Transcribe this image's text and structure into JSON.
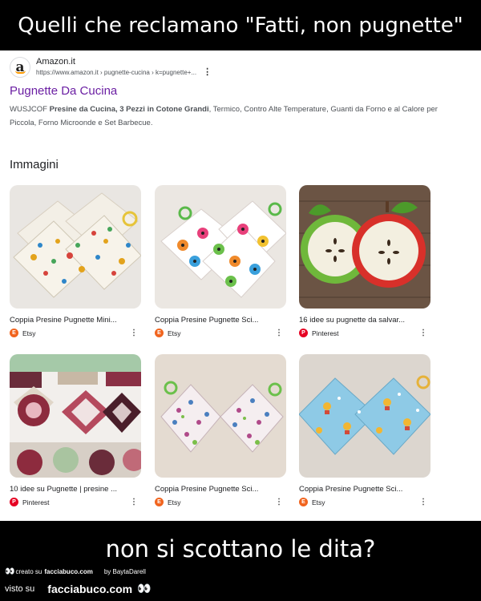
{
  "meme": {
    "top_text": "Quelli che reclamano \"Fatti, non pugnette\"",
    "bottom_text": "non si scottano le dita?",
    "credit_prefix": "creato su",
    "credit_site": "facciabuco.com",
    "credit_by": "by BaytaDarell",
    "visto_label": "visto su",
    "visto_site": "facciabuco.com"
  },
  "result": {
    "site_name": "Amazon.it",
    "url": "https://www.amazon.it › pugnette-cucina › k=pugnette+...",
    "title": "Pugnette Da Cucina",
    "desc_brand": "WUSJCOF",
    "desc_bold": "Presine da Cucina, 3 Pezzi in Cotone Grandi",
    "desc_rest": ", Termico, Contro Alte Temperature, Guanti da Forno e al Calore per Piccola, Forno Microonde e Set Barbecue."
  },
  "images_heading": "Immagini",
  "images": [
    {
      "caption": "Coppia Presine Pugnette Mini...",
      "source": "Etsy",
      "source_icon": "etsy-icon",
      "color": "#f1641e"
    },
    {
      "caption": "Coppia Presine Pugnette Sci...",
      "source": "Etsy",
      "source_icon": "etsy-icon",
      "color": "#f1641e"
    },
    {
      "caption": "16 idee su pugnette da salvar...",
      "source": "Pinterest",
      "source_icon": "pinterest-icon",
      "color": "#e60023"
    },
    {
      "caption": "10 idee su Pugnette | presine ...",
      "source": "Pinterest",
      "source_icon": "pinterest-icon",
      "color": "#e60023"
    },
    {
      "caption": "Coppia Presine Pugnette Sci...",
      "source": "Etsy",
      "source_icon": "etsy-icon",
      "color": "#f1641e"
    },
    {
      "caption": "Coppia Presine Pugnette Sci...",
      "source": "Etsy",
      "source_icon": "etsy-icon",
      "color": "#f1641e"
    }
  ]
}
